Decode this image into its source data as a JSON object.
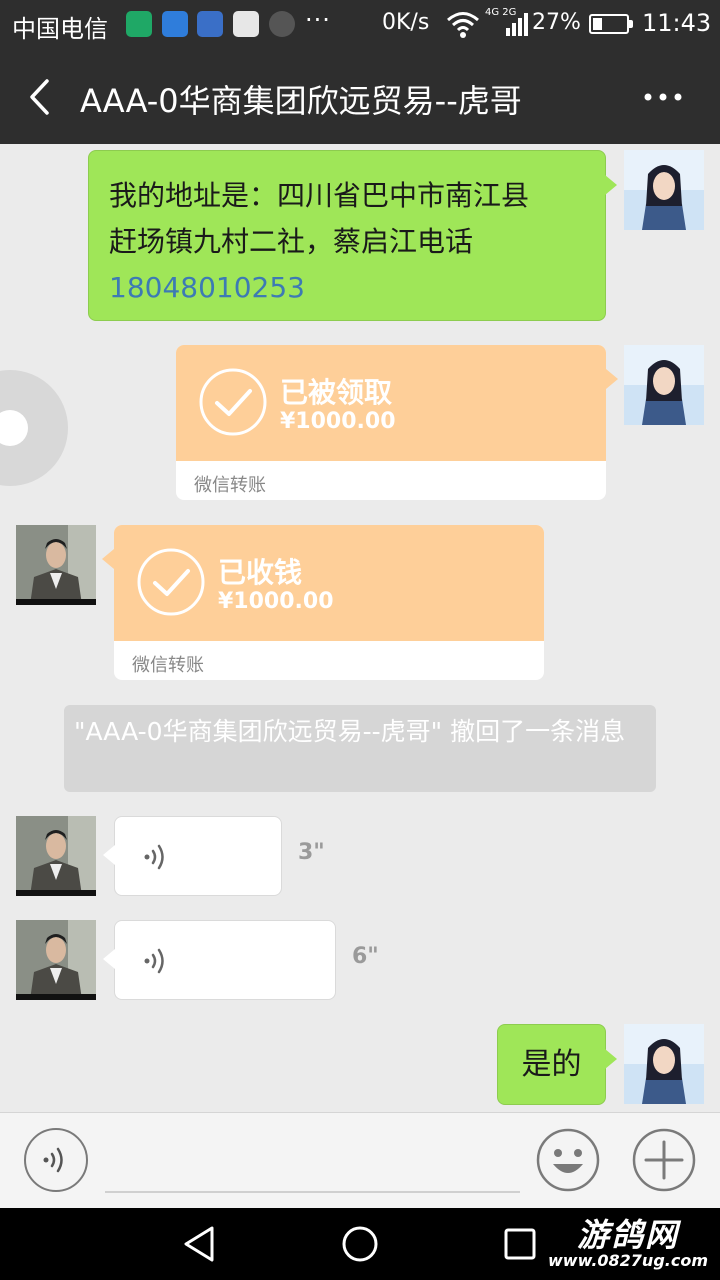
{
  "status_bar": {
    "carrier": "中国电信",
    "more": "···",
    "speed": "0K/s",
    "network": "4G 2G",
    "battery": "27%",
    "battery_level": 0.27,
    "time": "11:43"
  },
  "chat": {
    "title": "AAA-0华商集团欣远贸易--虎哥",
    "messages": {
      "address": {
        "line1": "我的地址是：四川省巴中市南江县",
        "line2": "赶场镇九村二社，蔡启江电话",
        "phone": "18048010253"
      },
      "transfer_received_by_peer": {
        "status": "已被领取",
        "amount": "¥1000.00",
        "label": "微信转账"
      },
      "transfer_incoming": {
        "status": "已收钱",
        "amount": "¥1000.00",
        "label": "微信转账"
      },
      "recall_notice": "\"AAA-0华商集团欣远贸易--虎哥\" 撤回了一条消息",
      "voice_1": {
        "duration": "3\""
      },
      "voice_2": {
        "duration": "6\""
      },
      "reply": "是的"
    }
  },
  "watermark": {
    "name": "游鸽网",
    "url": "www.0827ug.com"
  },
  "colors": {
    "title_bar": "#2e2e2e",
    "bubble_green": "#9fe658",
    "transfer_orange": "#fecf99",
    "chat_bg": "#ebebeb",
    "link_blue": "#3d7ab4"
  },
  "icons": {
    "back": "chevron-left-icon",
    "more": "more-horizontal-icon",
    "voice": "voice-wave-icon",
    "emoji": "smiley-icon",
    "plus": "plus-icon"
  }
}
